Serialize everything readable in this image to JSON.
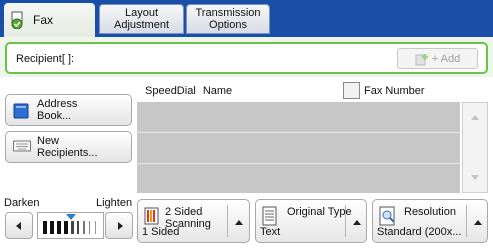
{
  "tabs": {
    "fax": "Fax",
    "layout_line1": "Layout",
    "layout_line2": "Adjustment",
    "transmission_line1": "Transmission",
    "transmission_line2": "Options"
  },
  "recipient": {
    "label": "Recipient[  ]:",
    "add_label": "+ Add"
  },
  "buttons": {
    "address_line1": "Address",
    "address_line2": "Book...",
    "new_line1": "New",
    "new_line2": "Recipients..."
  },
  "list": {
    "col_speeddial": "SpeedDial",
    "col_name": "Name",
    "fax_number_label": "Fax Number"
  },
  "density": {
    "darken": "Darken",
    "lighten": "Lighten"
  },
  "features": {
    "two_sided_line1": "2 Sided",
    "two_sided_line2": "Scanning",
    "two_sided_value": "1 Sided",
    "original_type_label": "Original Type",
    "original_type_value": "Text",
    "resolution_label": "Resolution",
    "resolution_value": "Standard (200x..."
  },
  "colors": {
    "tab_bar": "#1a4fa8",
    "accent_green": "#6cc24a",
    "list_bg": "#c7c7c7"
  }
}
